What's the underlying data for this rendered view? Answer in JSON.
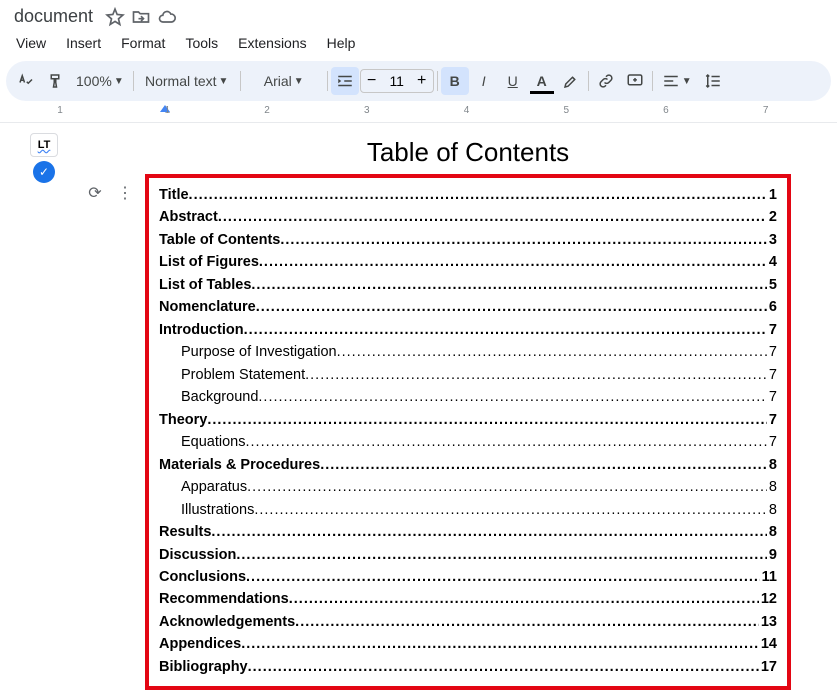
{
  "title_bar": {
    "doc_name": "document"
  },
  "menu": {
    "view": "View",
    "insert": "Insert",
    "format": "Format",
    "tools": "Tools",
    "extensions": "Extensions",
    "help": "Help"
  },
  "toolbar": {
    "zoom": "100%",
    "style": "Normal text",
    "font": "Arial",
    "font_size": "11"
  },
  "ruler": {
    "marks": [
      "1",
      "1",
      "2",
      "3",
      "4",
      "5",
      "6",
      "7"
    ]
  },
  "document": {
    "heading": "Table of Contents",
    "toc": [
      {
        "level": 1,
        "label": "Title",
        "page": "1"
      },
      {
        "level": 1,
        "label": "Abstract",
        "page": "2"
      },
      {
        "level": 1,
        "label": "Table of Contents",
        "page": "3"
      },
      {
        "level": 1,
        "label": "List of Figures",
        "page": "4"
      },
      {
        "level": 1,
        "label": "List of Tables",
        "page": "5"
      },
      {
        "level": 1,
        "label": "Nomenclature",
        "page": "6"
      },
      {
        "level": 1,
        "label": "Introduction",
        "page": "7"
      },
      {
        "level": 2,
        "label": "Purpose of Investigation",
        "page": "7"
      },
      {
        "level": 2,
        "label": "Problem Statement",
        "page": "7"
      },
      {
        "level": 2,
        "label": "Background",
        "page": "7"
      },
      {
        "level": 1,
        "label": "Theory",
        "page": "7"
      },
      {
        "level": 2,
        "label": "Equations",
        "page": "7"
      },
      {
        "level": 1,
        "label": "Materials & Procedures",
        "page": "8"
      },
      {
        "level": 2,
        "label": "Apparatus",
        "page": "8"
      },
      {
        "level": 2,
        "label": "Illustrations",
        "page": "8"
      },
      {
        "level": 1,
        "label": "Results",
        "page": "8"
      },
      {
        "level": 1,
        "label": "Discussion",
        "page": "9"
      },
      {
        "level": 1,
        "label": "Conclusions",
        "page": "11"
      },
      {
        "level": 1,
        "label": "Recommendations",
        "page": "12"
      },
      {
        "level": 1,
        "label": "Acknowledgements",
        "page": "13"
      },
      {
        "level": 1,
        "label": "Appendices",
        "page": "14"
      },
      {
        "level": 1,
        "label": "Bibliography",
        "page": "17"
      }
    ]
  }
}
